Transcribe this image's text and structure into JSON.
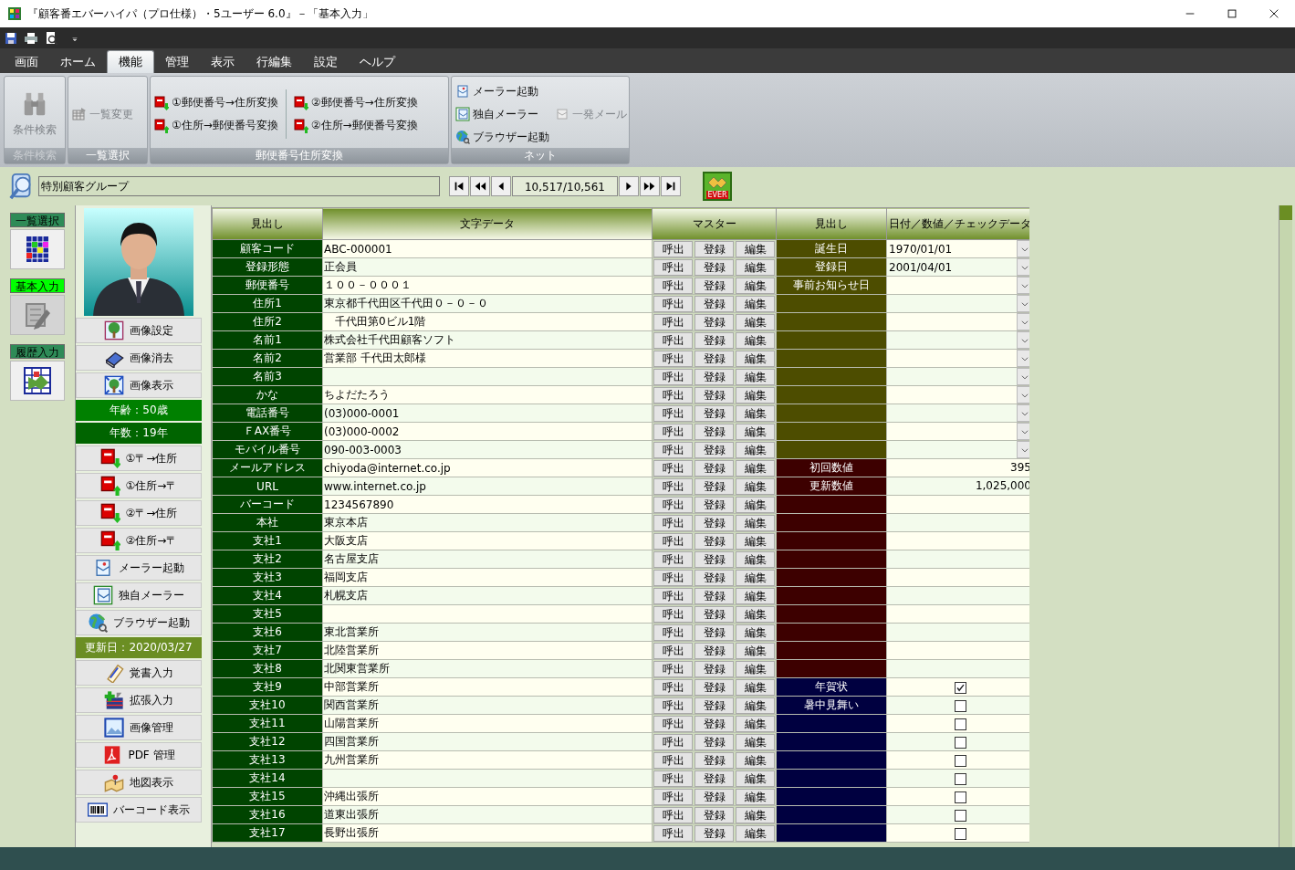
{
  "window": {
    "title": "『顧客番エバーハイパ（プロ仕様）・5ユーザー 6.0』－「基本入力」"
  },
  "menu_tabs": [
    {
      "label": "画面",
      "selected": false
    },
    {
      "label": "ホーム",
      "selected": false
    },
    {
      "label": "機能",
      "selected": true
    },
    {
      "label": "管理",
      "selected": false
    },
    {
      "label": "表示",
      "selected": false
    },
    {
      "label": "行編集",
      "selected": false
    },
    {
      "label": "設定",
      "selected": false
    },
    {
      "label": "ヘルプ",
      "selected": false
    }
  ],
  "ribbon": {
    "groups": [
      {
        "label": "条件検索",
        "disabled": true,
        "kind": "large",
        "columns": [
          [
            {
              "label": "条件検索",
              "disabled": true
            }
          ]
        ]
      },
      {
        "label": "一覧選択",
        "disabled": false,
        "kind": "small",
        "columns": [
          [
            {
              "label": "一覧変更",
              "disabled": true
            }
          ]
        ]
      },
      {
        "label": "郵便番号住所変換",
        "disabled": false,
        "kind": "small",
        "columns": [
          [
            {
              "label": "①郵便番号→住所変換",
              "disabled": false
            },
            {
              "label": "①住所→郵便番号変換",
              "disabled": false
            }
          ],
          [
            {
              "label": "②郵便番号→住所変換",
              "disabled": false
            },
            {
              "label": "②住所→郵便番号変換",
              "disabled": false
            }
          ]
        ]
      },
      {
        "label": "ネット",
        "disabled": false,
        "kind": "small",
        "columns": [
          [
            {
              "label": "メーラー起動",
              "disabled": false
            },
            {
              "label": "独自メーラー",
              "disabled": false
            },
            {
              "label": "ブラウザー起動",
              "disabled": false
            }
          ],
          [
            {
              "label": "一発メール",
              "disabled": true
            }
          ]
        ]
      }
    ]
  },
  "nav": {
    "group": "特別顧客グループ",
    "record": "10,517/10,561",
    "logo": "EVER"
  },
  "modes": [
    {
      "label": "一覧選択",
      "selected": false
    },
    {
      "label": "基本入力",
      "selected": true
    },
    {
      "label": "履歴入力",
      "selected": false
    }
  ],
  "side_panel": [
    {
      "kind": "button",
      "label": "画像設定"
    },
    {
      "kind": "button",
      "label": "画像消去"
    },
    {
      "kind": "button",
      "label": "画像表示"
    },
    {
      "kind": "info",
      "label": "年齢：50歳",
      "color": "#008000"
    },
    {
      "kind": "info",
      "label": "年数：19年",
      "color": "#006400"
    },
    {
      "kind": "button",
      "label": "①〒→住所"
    },
    {
      "kind": "button",
      "label": "①住所→〒"
    },
    {
      "kind": "button",
      "label": "②〒→住所"
    },
    {
      "kind": "button",
      "label": "②住所→〒"
    },
    {
      "kind": "button",
      "label": "メーラー起動"
    },
    {
      "kind": "button",
      "label": "独自メーラー"
    },
    {
      "kind": "button",
      "label": "ブラウザー起動"
    },
    {
      "kind": "info",
      "label": "更新日：2020/03/27",
      "color": "#6b8e23"
    },
    {
      "kind": "button",
      "label": "覚書入力"
    },
    {
      "kind": "button",
      "label": "拡張入力"
    },
    {
      "kind": "button",
      "label": "画像管理"
    },
    {
      "kind": "button",
      "label": "PDF 管理"
    },
    {
      "kind": "button",
      "label": "地図表示"
    },
    {
      "kind": "button",
      "label": "バーコード表示"
    }
  ],
  "table": {
    "columns": [
      "見出し",
      "文字データ",
      "マスター",
      "見出し",
      "日付／数値／チェックデータ"
    ],
    "rows": [
      {
        "label": "顧客コード",
        "text": "ABC-000001",
        "master": [
          "呼出",
          "登録",
          "編集"
        ],
        "kind": "date",
        "label2": "誕生日",
        "value": "1970/01/01"
      },
      {
        "label": "登録形態",
        "text": "正会員",
        "master": [
          "呼出",
          "登録",
          "編集"
        ],
        "kind": "date",
        "label2": "登録日",
        "value": "2001/04/01"
      },
      {
        "label": "郵便番号",
        "text": "１００－０００１",
        "master": [
          "呼出",
          "登録",
          "編集"
        ],
        "kind": "date",
        "label2": "事前お知らせ日"
      },
      {
        "label": "住所1",
        "text": "東京都千代田区千代田０－０－０",
        "master": [
          "呼出",
          "登録",
          "編集"
        ],
        "kind": "date"
      },
      {
        "label": "住所2",
        "text": "　千代田第0ビル1階",
        "master": [
          "呼出",
          "登録",
          "編集"
        ],
        "kind": "date"
      },
      {
        "label": "名前1",
        "text": "株式会社千代田顧客ソフト",
        "master": [
          "呼出",
          "登録",
          "編集"
        ],
        "kind": "date"
      },
      {
        "label": "名前2",
        "text": "営業部 千代田太郎様",
        "master": [
          "呼出",
          "登録",
          "編集"
        ],
        "kind": "date"
      },
      {
        "label": "名前3",
        "master": [
          "呼出",
          "登録",
          "編集"
        ],
        "kind": "date"
      },
      {
        "label": "かな",
        "text": "ちよだたろう",
        "master": [
          "呼出",
          "登録",
          "編集"
        ],
        "kind": "date"
      },
      {
        "label": "電話番号",
        "text": "(03)000-0001",
        "master": [
          "呼出",
          "登録",
          "編集"
        ],
        "kind": "date"
      },
      {
        "label": "ＦAX番号",
        "text": "(03)000-0002",
        "master": [
          "呼出",
          "登録",
          "編集"
        ],
        "kind": "date"
      },
      {
        "label": "モバイル番号",
        "text": "090-003-0003",
        "master": [
          "呼出",
          "登録",
          "編集"
        ],
        "kind": "date"
      },
      {
        "label": "メールアドレス",
        "text": "chiyoda@internet.co.jp",
        "master": [
          "呼出",
          "登録",
          "編集"
        ],
        "kind": "number",
        "label2": "初回数値",
        "value": "395"
      },
      {
        "label": "URL",
        "text": "www.internet.co.jp",
        "master": [
          "呼出",
          "登録",
          "編集"
        ],
        "kind": "number",
        "label2": "更新数値",
        "value": "1,025,000"
      },
      {
        "label": "バーコード",
        "text": "1234567890",
        "master": [
          "呼出",
          "登録",
          "編集"
        ],
        "kind": "number"
      },
      {
        "label": "本社",
        "text": "東京本店",
        "master": [
          "呼出",
          "登録",
          "編集"
        ],
        "kind": "number"
      },
      {
        "label": "支社1",
        "text": "大阪支店",
        "master": [
          "呼出",
          "登録",
          "編集"
        ],
        "kind": "number"
      },
      {
        "label": "支社2",
        "text": "名古屋支店",
        "master": [
          "呼出",
          "登録",
          "編集"
        ],
        "kind": "number"
      },
      {
        "label": "支社3",
        "text": "福岡支店",
        "master": [
          "呼出",
          "登録",
          "編集"
        ],
        "kind": "number"
      },
      {
        "label": "支社4",
        "text": "札幌支店",
        "master": [
          "呼出",
          "登録",
          "編集"
        ],
        "kind": "number"
      },
      {
        "label": "支社5",
        "master": [
          "呼出",
          "登録",
          "編集"
        ],
        "kind": "number"
      },
      {
        "label": "支社6",
        "text": "東北営業所",
        "master": [
          "呼出",
          "登録",
          "編集"
        ],
        "kind": "number"
      },
      {
        "label": "支社7",
        "text": "北陸営業所",
        "master": [
          "呼出",
          "登録",
          "編集"
        ],
        "kind": "number"
      },
      {
        "label": "支社8",
        "text": "北関東営業所",
        "master": [
          "呼出",
          "登録",
          "編集"
        ],
        "kind": "number"
      },
      {
        "label": "支社9",
        "text": "中部営業所",
        "master": [
          "呼出",
          "登録",
          "編集"
        ],
        "kind": "check",
        "label2": "年賀状",
        "checked": true
      },
      {
        "label": "支社10",
        "text": "関西営業所",
        "master": [
          "呼出",
          "登録",
          "編集"
        ],
        "kind": "check",
        "label2": "暑中見舞い",
        "checked": false
      },
      {
        "label": "支社11",
        "text": "山陽営業所",
        "master": [
          "呼出",
          "登録",
          "編集"
        ],
        "kind": "check",
        "checked": false
      },
      {
        "label": "支社12",
        "text": "四国営業所",
        "master": [
          "呼出",
          "登録",
          "編集"
        ],
        "kind": "check",
        "checked": false
      },
      {
        "label": "支社13",
        "text": "九州営業所",
        "master": [
          "呼出",
          "登録",
          "編集"
        ],
        "kind": "check",
        "checked": false
      },
      {
        "label": "支社14",
        "master": [
          "呼出",
          "登録",
          "編集"
        ],
        "kind": "check",
        "checked": false
      },
      {
        "label": "支社15",
        "text": "沖縄出張所",
        "master": [
          "呼出",
          "登録",
          "編集"
        ],
        "kind": "check",
        "checked": false
      },
      {
        "label": "支社16",
        "text": "道東出張所",
        "master": [
          "呼出",
          "登録",
          "編集"
        ],
        "kind": "check",
        "checked": false
      },
      {
        "label": "支社17",
        "text": "長野出張所",
        "master": [
          "呼出",
          "登録",
          "編集"
        ],
        "kind": "check",
        "checked": false
      }
    ]
  }
}
